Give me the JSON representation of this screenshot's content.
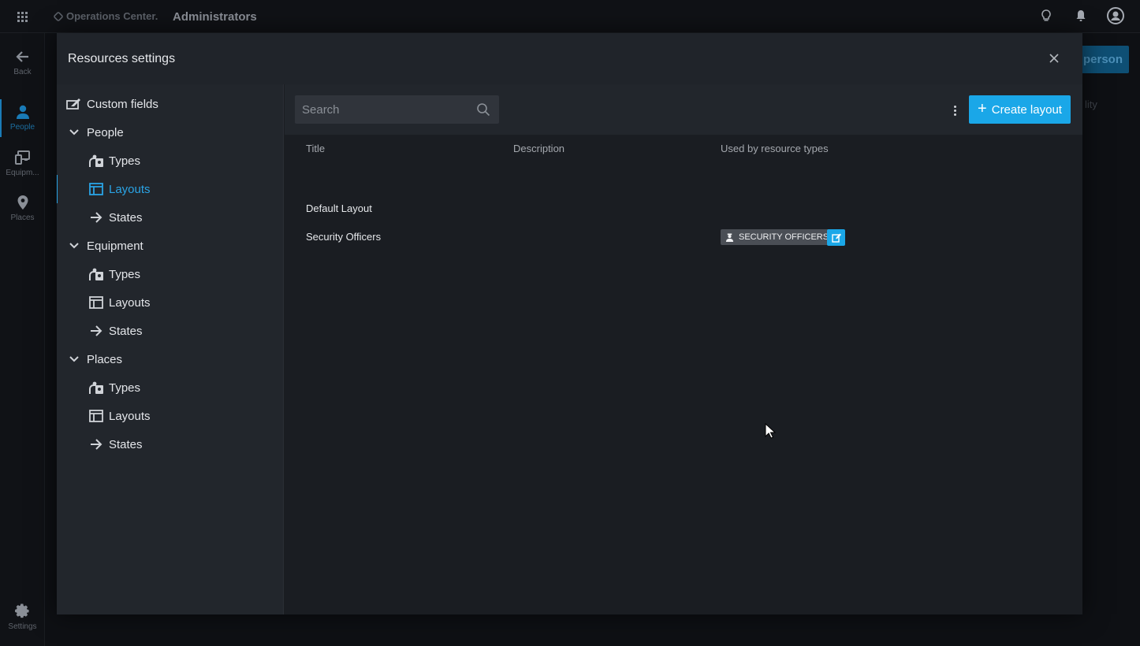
{
  "header": {
    "brand": "Operations Center.",
    "title": "Administrators"
  },
  "leftnav": {
    "items": [
      {
        "label": "Back",
        "icon": "arrow-left-icon"
      },
      {
        "label": "People",
        "icon": "person-icon"
      },
      {
        "label": "Equipm...",
        "icon": "devices-icon"
      },
      {
        "label": "Places",
        "icon": "map-pin-icon"
      },
      {
        "label": "Settings",
        "icon": "gear-icon"
      }
    ]
  },
  "background": {
    "button_label": "person",
    "text_hint": "lity"
  },
  "modal": {
    "title": "Resources settings",
    "sidebar": {
      "custom_fields": "Custom fields",
      "sections": [
        {
          "label": "People",
          "children": [
            "Types",
            "Layouts",
            "States"
          ]
        },
        {
          "label": "Equipment",
          "children": [
            "Types",
            "Layouts",
            "States"
          ]
        },
        {
          "label": "Places",
          "children": [
            "Types",
            "Layouts",
            "States"
          ]
        }
      ]
    },
    "toolbar": {
      "search_placeholder": "Search",
      "create_label": "Create layout"
    },
    "table": {
      "columns": [
        "Title",
        "Description",
        "Used by resource types"
      ],
      "rows": [
        {
          "title": "Default Layout",
          "description": "",
          "used_by": ""
        },
        {
          "title": "Security Officers",
          "description": "",
          "used_by": "SECURITY OFFICERS"
        }
      ]
    }
  },
  "colors": {
    "accent": "#1aa7e8",
    "active_nav": "#1a7bb7"
  }
}
